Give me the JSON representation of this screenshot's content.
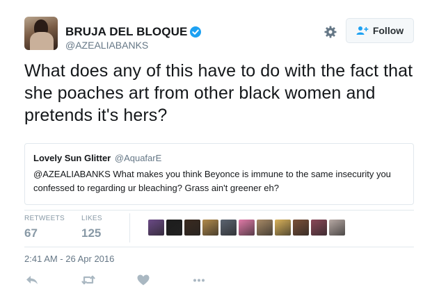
{
  "author": {
    "name": "BRUJA DEL BLOQUE",
    "handle": "@AZEALIABANKS",
    "verified": true
  },
  "follow_button": {
    "label": "Follow"
  },
  "tweet": {
    "text": "What does any of this have to do with the fact that she poaches art from other black women and pretends it's hers?"
  },
  "quoted_tweet": {
    "name": "Lovely Sun Glitter",
    "handle": "@AquafarE",
    "text": "@AZEALIABANKS What makes you think Beyonce is immune to the same insecurity you confessed to regarding ur bleaching? Grass ain't greener eh?"
  },
  "stats": {
    "retweets_label": "RETWEETS",
    "retweets_value": "67",
    "likes_label": "LIKES",
    "likes_value": "125"
  },
  "liker_avatars": [
    "#6b4a86",
    "#1d1d1d",
    "#3a2a1f",
    "#b28a4a",
    "#5b6470",
    "#e07aa8",
    "#a88a66",
    "#d9b25a",
    "#7a5038",
    "#8a4858",
    "#b7a9a4"
  ],
  "timestamp": "2:41 AM - 26 Apr 2016",
  "icons": {
    "gear": "gear-icon",
    "follow": "add-person-icon",
    "reply": "reply-icon",
    "retweet": "retweet-icon",
    "like": "heart-icon",
    "more": "more-icon"
  },
  "colors": {
    "accent": "#1da1f2",
    "muted": "#8899a6",
    "icon": "#aab8c2"
  }
}
